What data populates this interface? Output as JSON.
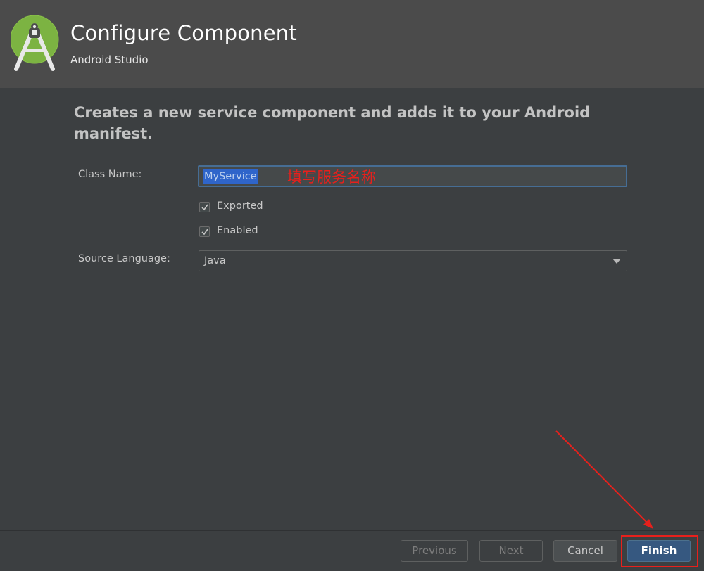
{
  "header": {
    "title": "Configure Component",
    "subtitle": "Android Studio",
    "logo_icon": "android-studio-logo-icon",
    "background": "#4b4b4b"
  },
  "description": "Creates a new service component and adds it to your Android manifest.",
  "form": {
    "class_name": {
      "label": "Class Name:",
      "value": "MyService"
    },
    "exported": {
      "label": "Exported",
      "checked": true
    },
    "enabled": {
      "label": "Enabled",
      "checked": true
    },
    "source_language": {
      "label": "Source Language:",
      "value": "Java"
    }
  },
  "annotation": {
    "text": "填写服务名称",
    "color": "#e8201c"
  },
  "footer": {
    "previous_label": "Previous",
    "next_label": "Next",
    "cancel_label": "Cancel",
    "finish_label": "Finish"
  },
  "colors": {
    "background": "#3c3f41",
    "selection": "#2f65ca",
    "accent_blue": "#365880",
    "annotation_red": "#e8201c"
  }
}
